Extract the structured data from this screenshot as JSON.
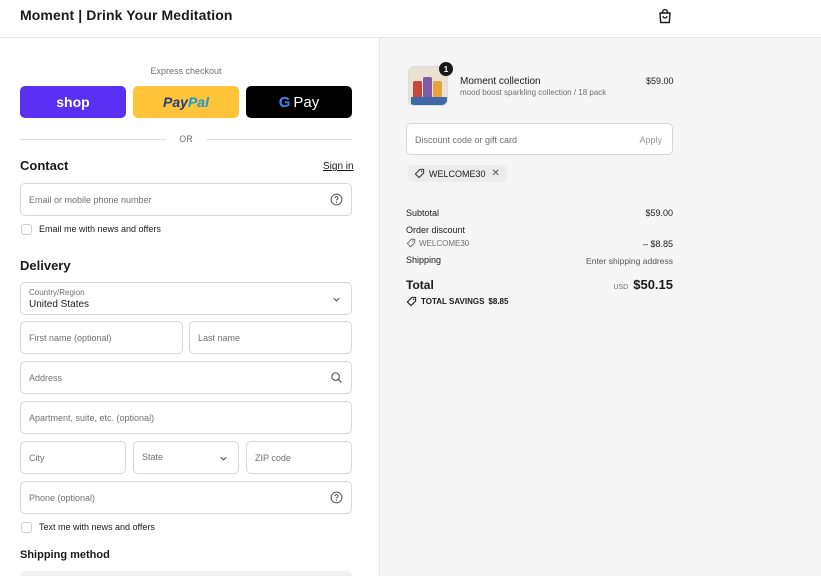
{
  "header": {
    "brand": "Moment | Drink Your Meditation",
    "bag_icon": "shopping-bag-icon"
  },
  "express": {
    "label": "Express checkout",
    "shop_label": "shop",
    "paypal_label_1": "Pay",
    "paypal_label_2": "Pal",
    "gpay_label": "Pay",
    "or_label": "OR"
  },
  "contact": {
    "title": "Contact",
    "signin": "Sign in",
    "email_placeholder": "Email or mobile phone number",
    "news_label": "Email me with news and offers"
  },
  "delivery": {
    "title": "Delivery",
    "country_label": "Country/Region",
    "country_value": "United States",
    "first_name_placeholder": "First name (optional)",
    "last_name_placeholder": "Last name",
    "address_placeholder": "Address",
    "apartment_placeholder": "Apartment, suite, etc. (optional)",
    "city_placeholder": "City",
    "state_placeholder": "State",
    "zip_placeholder": "ZIP code",
    "phone_placeholder": "Phone (optional)",
    "text_label": "Text me with news and offers"
  },
  "shipping_method": {
    "title": "Shipping method"
  },
  "order": {
    "quantity": "1",
    "product_name": "Moment collection",
    "product_variant": "mood boost sparkling collection / 18 pack",
    "product_price": "$59.00",
    "discount_placeholder": "Discount code or gift card",
    "apply_label": "Apply",
    "applied_code": "WELCOME30",
    "subtotal_label": "Subtotal",
    "subtotal_value": "$59.00",
    "order_discount_label": "Order discount",
    "order_discount_code": "WELCOME30",
    "order_discount_value": "– $8.85",
    "shipping_label": "Shipping",
    "shipping_value": "Enter shipping address",
    "total_label": "Total",
    "currency": "USD",
    "total_value": "$50.15",
    "savings_label": "TOTAL SAVINGS",
    "savings_value": "$8.85"
  },
  "colors": {
    "shop_purple": "#5a31f4",
    "paypal_yellow": "#ffc439",
    "gpay_black": "#000000",
    "summary_bg": "#f5f5f5"
  }
}
